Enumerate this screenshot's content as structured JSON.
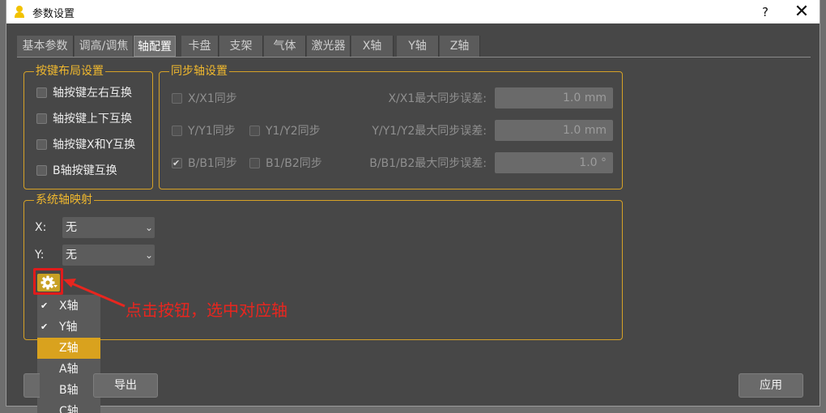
{
  "window": {
    "title": "参数设置",
    "help": "?",
    "close": "✕"
  },
  "tabs": [
    {
      "label": "基本参数"
    },
    {
      "label": "调高/调焦"
    },
    {
      "label": "轴配置"
    },
    {
      "label": "卡盘"
    },
    {
      "label": "支架"
    },
    {
      "label": "气体"
    },
    {
      "label": "激光器"
    },
    {
      "label": "X轴"
    },
    {
      "label": "Y轴"
    },
    {
      "label": "Z轴"
    }
  ],
  "active_tab": "轴配置",
  "key_layout": {
    "title": "按键布局设置",
    "options": [
      {
        "label": "轴按键左右互换",
        "checked": false
      },
      {
        "label": "轴按键上下互换",
        "checked": false
      },
      {
        "label": "轴按键X和Y互换",
        "checked": false
      },
      {
        "label": "B轴按键互换",
        "checked": false
      }
    ]
  },
  "sync_axis": {
    "title": "同步轴设置",
    "rows": [
      {
        "a": "X/X1同步",
        "a_checked": false,
        "b": "",
        "error_label": "X/X1最大同步误差:",
        "value": "1.0 mm"
      },
      {
        "a": "Y/Y1同步",
        "a_checked": false,
        "b": "Y1/Y2同步",
        "b_checked": false,
        "error_label": "Y/Y1/Y2最大同步误差:",
        "value": "1.0 mm"
      },
      {
        "a": "B/B1同步",
        "a_checked": true,
        "b": "B1/B2同步",
        "b_checked": false,
        "error_label": "B/B1/B2最大同步误差:",
        "value": "1.0 °"
      }
    ]
  },
  "axis_map": {
    "title": "系统轴映射",
    "x_label": "X:",
    "x_value": "无",
    "y_label": "Y:",
    "y_value": "无"
  },
  "menu": {
    "items": [
      {
        "label": "X轴",
        "checked": true
      },
      {
        "label": "Y轴",
        "checked": true
      },
      {
        "label": "Z轴",
        "checked": false,
        "selected": true
      },
      {
        "label": "A轴",
        "checked": false
      },
      {
        "label": "B轴",
        "checked": false
      },
      {
        "label": "C轴",
        "checked": false
      }
    ]
  },
  "annotation": "点击按钮，选中对应轴",
  "footer": {
    "export": "导出",
    "apply": "应用"
  },
  "colors": {
    "accent": "#d9a21e",
    "group_border": "#d6a227",
    "annotation": "#e8261f"
  }
}
